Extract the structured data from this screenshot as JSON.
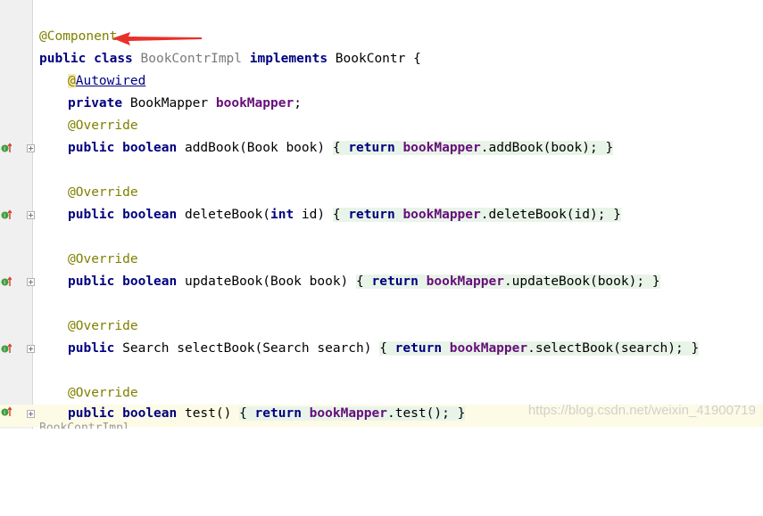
{
  "editor": {
    "lines": {
      "l1": {
        "annotation": "@Component"
      },
      "l2": {
        "kw1": "public",
        "kw2": "class",
        "classname": "BookContrImpl",
        "kw3": "implements",
        "iface": "BookContr",
        "brace": " {"
      },
      "l3": {
        "at": "@",
        "name": "Autowired"
      },
      "l4": {
        "kw": "private",
        "type": " BookMapper ",
        "field": "bookMapper",
        "semi": ";"
      },
      "l5": {
        "annotation": "@Override"
      },
      "l6": {
        "kw1": "public",
        "kw2": "boolean",
        "sig": " addBook(Book book) ",
        "open": "{ ",
        "ret": "return",
        "field": "bookMapper",
        "call": ".addBook(book); ",
        "close": "}"
      },
      "l8": {
        "annotation": "@Override"
      },
      "l9": {
        "kw1": "public",
        "kw2": "boolean",
        "sig1": " deleteBook(",
        "kwint": "int",
        "sig2": " id) ",
        "open": "{ ",
        "ret": "return",
        "field": "bookMapper",
        "call": ".deleteBook(id); ",
        "close": "}"
      },
      "l11": {
        "annotation": "@Override"
      },
      "l12": {
        "kw1": "public",
        "kw2": "boolean",
        "sig": " updateBook(Book book) ",
        "open": "{ ",
        "ret": "return",
        "field": "bookMapper",
        "call": ".updateBook(book); ",
        "close": "}"
      },
      "l14": {
        "annotation": "@Override"
      },
      "l15": {
        "kw1": "public",
        "sig": " Search selectBook(Search search) ",
        "open": "{ ",
        "ret": "return",
        "field": "bookMapper",
        "call": ".selectBook(search); ",
        "close": "}"
      },
      "l17": {
        "annotation": "@Override"
      },
      "l18": {
        "kw1": "public",
        "kw2": "boolean",
        "sig": " test() ",
        "open": "{ ",
        "ret": "return",
        "field": "bookMapper",
        "call": ".test(); ",
        "close": "}"
      },
      "l19": {
        "partial": "BookContrImpl"
      }
    }
  },
  "watermark": "https://blog.csdn.net/weixin_41900719",
  "colors": {
    "keyword": "#000080",
    "annotation": "#808000",
    "field": "#660e7a",
    "arrow": "#e8312a",
    "marker_green": "#3e9e3e",
    "marker_red": "#d23c2c"
  }
}
